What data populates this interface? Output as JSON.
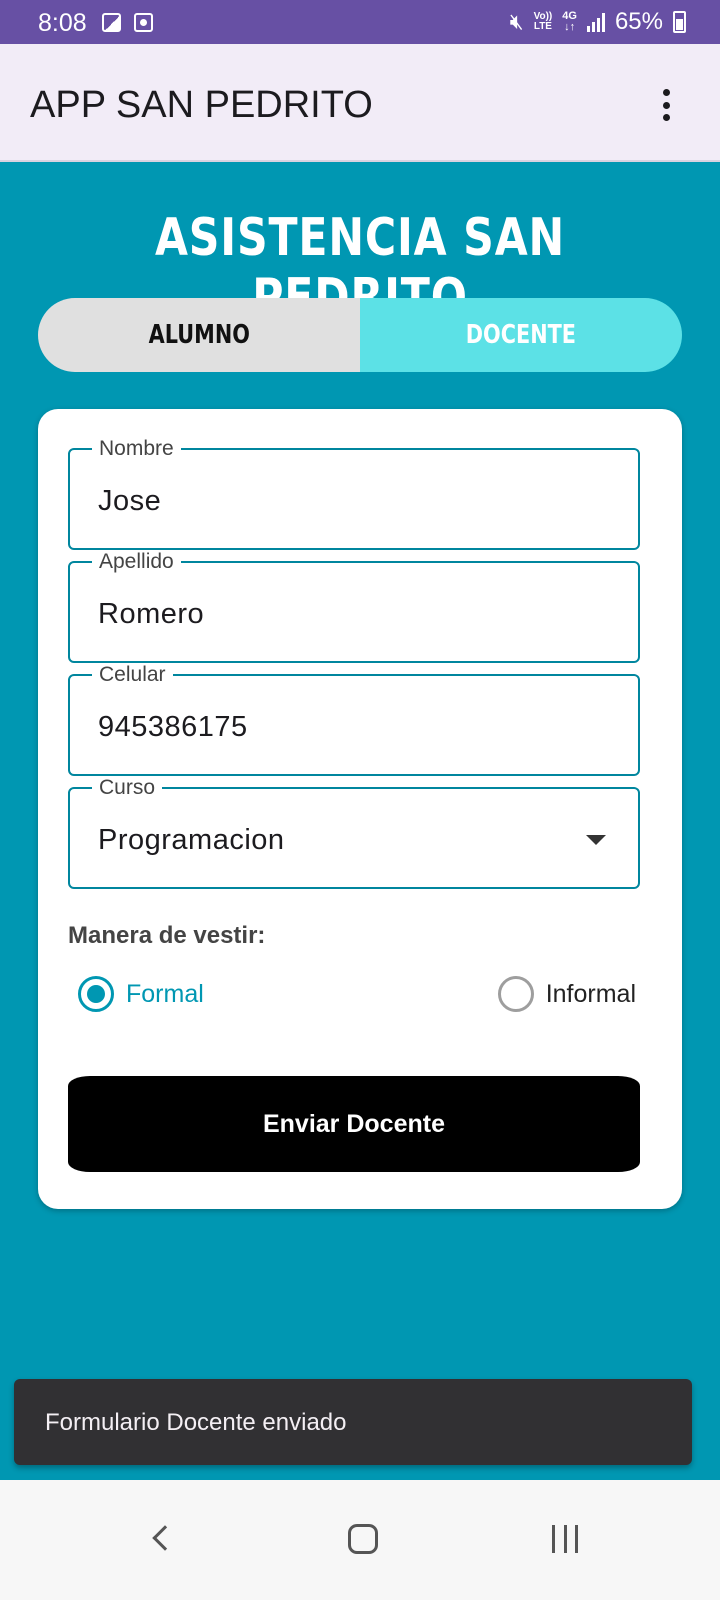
{
  "status_bar": {
    "time": "8:08",
    "volte_line1": "Vo))",
    "volte_line2": "LTE",
    "network": "4G",
    "battery": "65%",
    "icons": [
      "gallery-icon",
      "screen-record-icon",
      "mute-icon",
      "volte-icon",
      "network-4g-icon",
      "signal-icon",
      "battery-icon"
    ]
  },
  "app_bar": {
    "title": "APP SAN PEDRITO",
    "menu_icon": "more-vert-icon"
  },
  "heading": "ASISTENCIA SAN PEDRITO",
  "segments": [
    {
      "label": "ALUMNO",
      "selected": false
    },
    {
      "label": "DOCENTE",
      "selected": true
    }
  ],
  "form": {
    "fields": [
      {
        "label": "Nombre",
        "value": "Jose"
      },
      {
        "label": "Apellido",
        "value": "Romero"
      },
      {
        "label": "Celular",
        "value": "945386175"
      },
      {
        "label": "Curso",
        "value": "Programacion",
        "type": "dropdown"
      }
    ],
    "dress_label": "Manera de vestir:",
    "dress_options": [
      {
        "label": "Formal",
        "selected": true
      },
      {
        "label": "Informal",
        "selected": false
      }
    ],
    "submit_label": "Enviar Docente"
  },
  "snackbar": {
    "message": "Formulario Docente enviado"
  },
  "nav_bar": {
    "buttons": [
      "back-icon",
      "home-icon",
      "recents-icon"
    ]
  },
  "colors": {
    "status_bar": "#6750a4",
    "app_bar": "#f2ecf7",
    "background": "#0097b2",
    "segment_active": "#5ce1e6",
    "segment_inactive": "#e0e0e0",
    "field_border": "#00869e",
    "button": "#000000",
    "snackbar": "#313033"
  }
}
